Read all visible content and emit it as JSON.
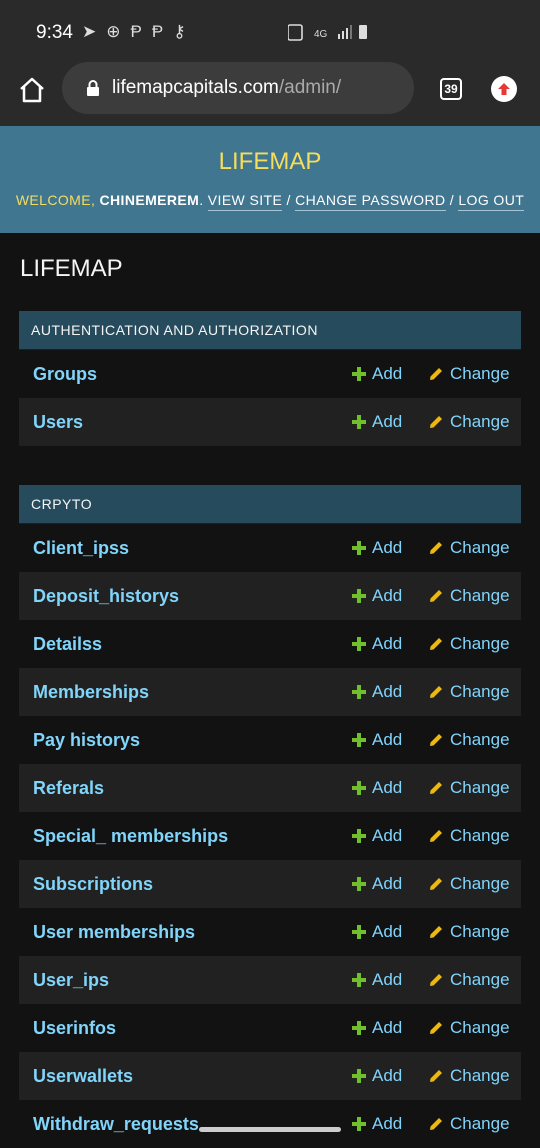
{
  "status": {
    "time": "9:34"
  },
  "browser": {
    "url_domain": "lifemapcapitals.com",
    "url_path": "/admin/",
    "tabs_count": "39"
  },
  "header": {
    "branding": "LIFEMAP",
    "welcome": "WELCOME, ",
    "username": "CHINEMEREM",
    "view_site": "VIEW SITE",
    "change_password": "CHANGE PASSWORD",
    "log_out": "LOG OUT"
  },
  "page_title": "LIFEMAP",
  "add_label": "Add",
  "change_label": "Change",
  "modules": [
    {
      "caption": "AUTHENTICATION AND AUTHORIZATION",
      "models": [
        "Groups",
        "Users"
      ]
    },
    {
      "caption": "CRPYTO",
      "models": [
        "Client_ipss",
        "Deposit_historys",
        "Detailss",
        "Memberships",
        "Pay historys",
        "Referals",
        "Special_ memberships",
        "Subscriptions",
        "User memberships",
        "User_ips",
        "Userinfos",
        "Userwallets",
        "Withdraw_requests"
      ]
    }
  ],
  "colors": {
    "header_bg": "#417690",
    "caption_bg": "#264b5d",
    "link": "#81d4fa",
    "add_icon": "#70bf2b",
    "change_icon": "#efb80b",
    "branding": "#f5dd5d"
  }
}
